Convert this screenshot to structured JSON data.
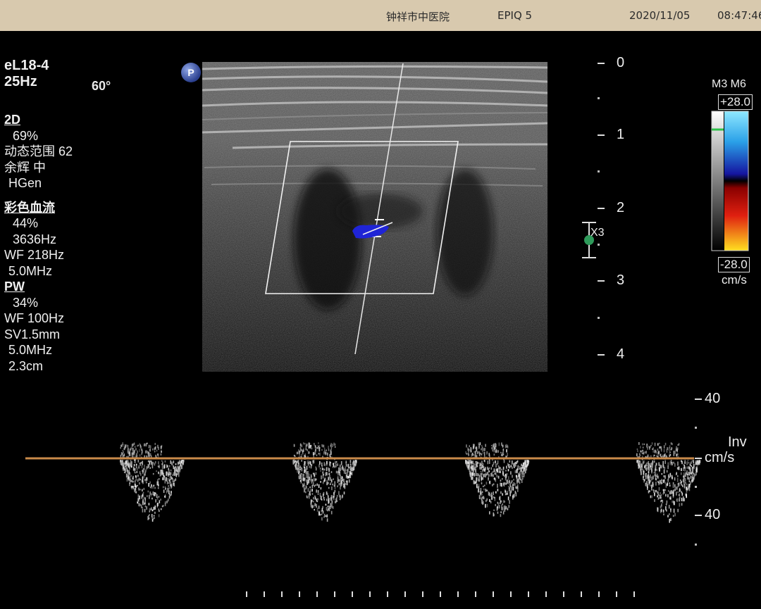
{
  "header": {
    "hospital": "钟祥市中医院",
    "system": "EPIQ 5",
    "date": "2020/11/05",
    "time": "08:47:46"
  },
  "probe": {
    "name": "eL18-4",
    "frame_rate": "25Hz",
    "angle": "60°",
    "badge": "P"
  },
  "params": {
    "mode_2d": "2D",
    "gain_2d": "69%",
    "dynamic_range": "动态范围 62",
    "persistence": "余辉 中",
    "harmonic": "HGen",
    "color_mode": "彩色血流",
    "color_gain": "44%",
    "color_prf": "3636Hz",
    "color_wf": "WF 218Hz",
    "color_freq": "5.0MHz",
    "pw_mode": "PW",
    "pw_gain": "34%",
    "pw_wf": "WF 100Hz",
    "pw_sv": "SV1.5mm",
    "pw_freq": "5.0MHz",
    "pw_depth": "2.3cm"
  },
  "depth_scale": {
    "labels": [
      "0",
      "1",
      "2",
      "3",
      "4"
    ],
    "zoom": "X3"
  },
  "colorbar": {
    "mode": "M3 M6",
    "max": "+28.0",
    "min": "-28.0",
    "unit": "cm/s"
  },
  "doppler_scale": {
    "top": "40",
    "bottom": "40",
    "invert": "Inv",
    "unit": "cm/s"
  },
  "colors": {
    "header_bg": "#d8c9ae",
    "baseline": "#c98a4a",
    "flow_blue": "#1f24d6",
    "roi": "#f2f2f2"
  }
}
